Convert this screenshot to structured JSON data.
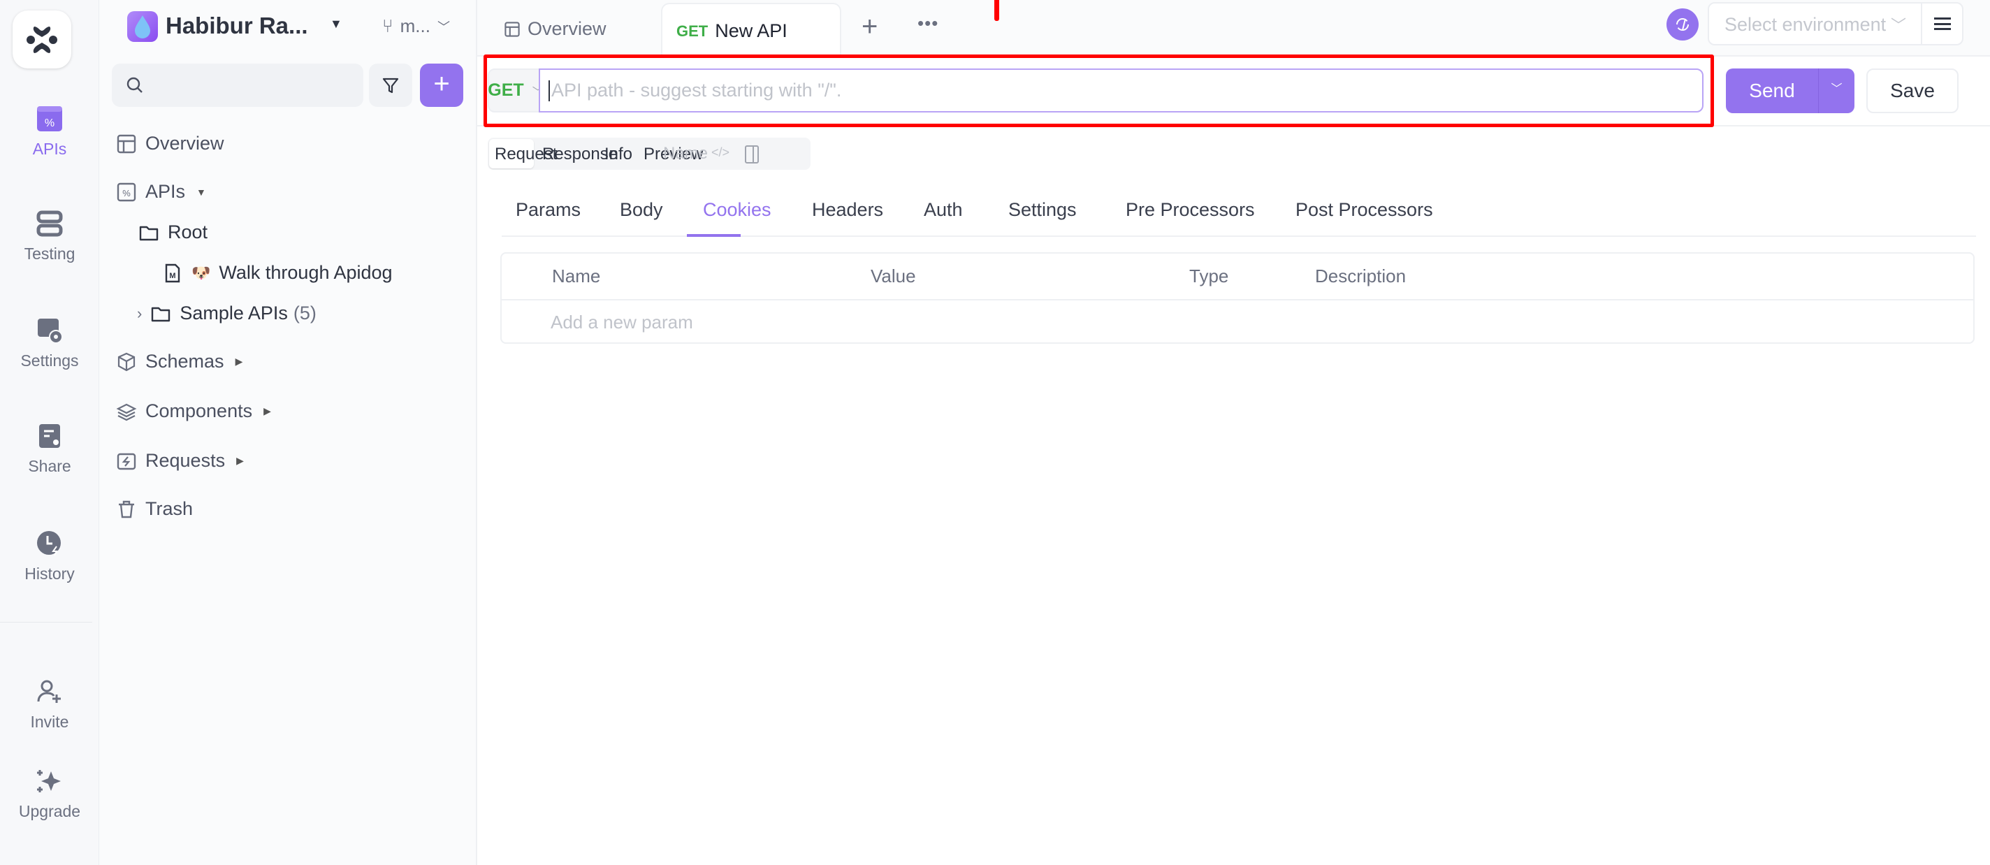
{
  "rail": {
    "items": [
      {
        "label": "APIs",
        "icon": "apis-icon",
        "active": true
      },
      {
        "label": "Testing",
        "icon": "testing-icon"
      },
      {
        "label": "Settings",
        "icon": "settings-icon"
      },
      {
        "label": "Share",
        "icon": "share-icon"
      },
      {
        "label": "History",
        "icon": "history-icon"
      },
      {
        "label": "Invite",
        "icon": "invite-icon"
      },
      {
        "label": "Upgrade",
        "icon": "upgrade-icon"
      }
    ]
  },
  "sidebar": {
    "project_name": "Habibur Ra...",
    "branch": "m...",
    "search_placeholder": "",
    "tree": [
      {
        "label": "Overview"
      },
      {
        "label": "APIs"
      },
      {
        "label": "Root"
      },
      {
        "label": "Walk through Apidog",
        "emoji": "🐶"
      },
      {
        "label": "Sample APIs",
        "count": "(5)"
      },
      {
        "label": "Schemas"
      },
      {
        "label": "Components"
      },
      {
        "label": "Requests"
      },
      {
        "label": "Trash"
      }
    ]
  },
  "tabs": {
    "overview": "Overview",
    "active_method": "GET",
    "active_label": "New API"
  },
  "env": {
    "placeholder": "Select environment"
  },
  "request": {
    "method": "GET",
    "path_placeholder": "API path - suggest starting with \"/\".",
    "send": "Send",
    "save": "Save"
  },
  "view_tabs": [
    "Request",
    "Response",
    "Info",
    "Preview"
  ],
  "name_placeholder": "Name",
  "sub_tabs": [
    "Params",
    "Body",
    "Cookies",
    "Headers",
    "Auth",
    "Settings",
    "Pre Processors",
    "Post Processors"
  ],
  "active_sub_tab": "Cookies",
  "table": {
    "columns": [
      "Name",
      "Value",
      "Type",
      "Description"
    ],
    "add_placeholder": "Add a new param"
  },
  "colors": {
    "accent": "#9373ee",
    "get": "#3fae48",
    "highlight": "#ff0000"
  }
}
